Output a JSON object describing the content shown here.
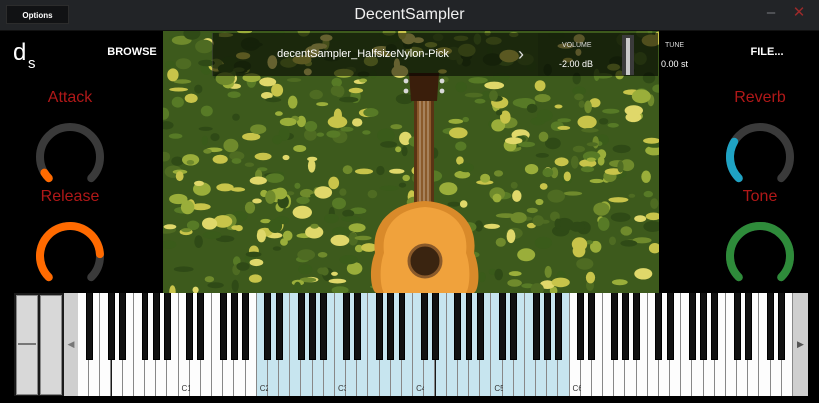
{
  "window": {
    "title": "DecentSampler",
    "options_label": "Options",
    "minimize_glyph": "–",
    "close_glyph": "✕"
  },
  "header": {
    "browse_label": "BROWSE",
    "preset_name": "decentSampler_HalfsizeNylon-Pick",
    "next_glyph": "›",
    "volume_label": "VOLUME",
    "volume_value": "-2.00 dB",
    "volume_level": 0.93,
    "tune_label": "TUNE",
    "tune_value": "0.00 st",
    "file_label": "FILE..."
  },
  "knobs": [
    {
      "id": "attack",
      "label": "Attack",
      "value": 0.05,
      "color": "#ff6a00"
    },
    {
      "id": "release",
      "label": "Release",
      "value": 0.82,
      "color": "#ff6a00"
    },
    {
      "id": "reverb",
      "label": "Reverb",
      "value": 0.28,
      "color": "#1fa3c4"
    },
    {
      "id": "tone",
      "label": "Tone",
      "value": 1.0,
      "color": "#2e8b3a"
    }
  ],
  "colors": {
    "knob_track": "#3a3a3a",
    "knob_label": "#b01818",
    "key_range": "#c7e5ef"
  },
  "keyboard": {
    "note_labels": [
      "C1",
      "C2",
      "C3",
      "C4",
      "C5",
      "C6"
    ],
    "left_arrow": "◀",
    "right_arrow": "▶"
  }
}
